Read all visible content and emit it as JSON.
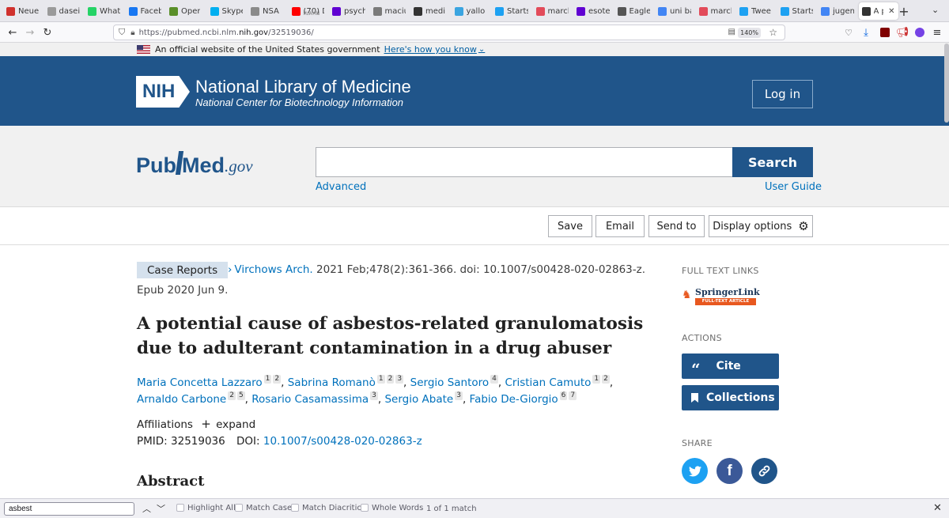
{
  "browser": {
    "tabs": [
      {
        "label": "Neue",
        "icon": "z-icon",
        "color": "#d0312d"
      },
      {
        "label": "daseinsa",
        "icon": "blank-page-icon",
        "color": "#9a9a9a"
      },
      {
        "label": "What",
        "icon": "whatsapp-icon",
        "color": "#25d366"
      },
      {
        "label": "Faceb",
        "icon": "facebook-icon",
        "color": "#1877f2"
      },
      {
        "label": "Oper",
        "icon": "app-icon",
        "color": "#5a8f29"
      },
      {
        "label": "Skype",
        "icon": "skype-icon",
        "color": "#00aff0"
      },
      {
        "label": "NSA",
        "icon": "flag-icon",
        "color": "#8a8a8a"
      },
      {
        "label": "(70) D",
        "sublabel": "PLAYIN",
        "icon": "youtube-icon",
        "color": "#ff0000"
      },
      {
        "label": "psych",
        "icon": "yahoo-icon",
        "color": "#6001d2"
      },
      {
        "label": "maciu",
        "icon": "globe-icon",
        "color": "#7a7a7a"
      },
      {
        "label": "medi",
        "icon": "github-icon",
        "color": "#333333"
      },
      {
        "label": "yallo",
        "icon": "bar-chart-icon",
        "color": "#3aa4e0"
      },
      {
        "label": "Starts",
        "icon": "twitter-icon",
        "color": "#1da1f2"
      },
      {
        "label": "marcl",
        "icon": "page-icon",
        "color": "#e24b5a"
      },
      {
        "label": "esote",
        "icon": "yahoo-icon",
        "color": "#6001d2"
      },
      {
        "label": "Eagle",
        "icon": "wikipedia-icon",
        "color": "#555555"
      },
      {
        "label": "uni ba",
        "icon": "google-icon",
        "color": "#4285f4"
      },
      {
        "label": "marcl",
        "icon": "page-icon",
        "color": "#e24b5a"
      },
      {
        "label": "Twee",
        "icon": "tweetdeck-icon",
        "color": "#1da1f2"
      },
      {
        "label": "Starts",
        "icon": "twitter-icon",
        "color": "#1da1f2"
      },
      {
        "label": "jugen",
        "icon": "google-icon",
        "color": "#4285f4"
      },
      {
        "label": "A p",
        "icon": "pubmed-tab-icon",
        "color": "#333333",
        "active": true
      }
    ],
    "new_tab": "+",
    "url_prefix": "https://pubmed.ncbi.nlm.",
    "url_domain": "nih.gov",
    "url_path": "/32519036/",
    "zoom": "140%"
  },
  "gov_banner": {
    "text": "An official website of the United States government",
    "link": "Here's how you know"
  },
  "nlm": {
    "logo": "NIH",
    "title": "National Library of Medicine",
    "subtitle": "National Center for Biotechnology Information",
    "login": "Log in"
  },
  "pubmed": {
    "logo_pub": "Pub",
    "logo_med": "Med",
    "logo_gov": ".gov",
    "search_value": "",
    "search_button": "Search",
    "advanced": "Advanced",
    "user_guide": "User Guide"
  },
  "toolbar": {
    "save": "Save",
    "email": "Email",
    "send_to": "Send to",
    "display_options": "Display options"
  },
  "article": {
    "type_badge": "Case Reports",
    "journal": "Virchows Arch.",
    "citation": "2021 Feb;478(2):361-366. doi: 10.1007/s00428-020-02863-z.",
    "epub": "Epub 2020 Jun 9.",
    "title_line1": "A potential cause of asbestos-related granulomatosis",
    "title_line2": "due to adulterant contamination in a drug abuser",
    "authors": [
      {
        "name": "Maria Concetta Lazzaro",
        "aff": [
          "1",
          "2"
        ]
      },
      {
        "name": "Sabrina Romanò",
        "aff": [
          "1",
          "2",
          "3"
        ]
      },
      {
        "name": "Sergio Santoro",
        "aff": [
          "4"
        ]
      },
      {
        "name": "Cristian Camuto",
        "aff": [
          "1",
          "2"
        ]
      },
      {
        "name": "Arnaldo Carbone",
        "aff": [
          "2",
          "5"
        ]
      },
      {
        "name": "Rosario Casamassima",
        "aff": [
          "3"
        ]
      },
      {
        "name": "Sergio Abate",
        "aff": [
          "3"
        ]
      },
      {
        "name": "Fabio De-Giorgio",
        "aff": [
          "6",
          "7"
        ]
      }
    ],
    "affiliations_label": "Affiliations",
    "expand": "expand",
    "pmid_label": "PMID:",
    "pmid": "32519036",
    "doi_label": "DOI:",
    "doi": "10.1007/s00428-020-02863-z",
    "abstract_heading": "Abstract"
  },
  "sidebar": {
    "full_text_links": "FULL TEXT LINKS",
    "springer_name": "SpringerLink",
    "springer_sub": "FULL-TEXT ARTICLE",
    "actions": "ACTIONS",
    "cite": "Cite",
    "collections": "Collections",
    "share": "SHARE"
  },
  "findbar": {
    "query": "asbest",
    "highlight_all": "Highlight All",
    "match_case": "Match Case",
    "match_diacritics": "Match Diacritics",
    "whole_words": "Whole Words",
    "result": "1 of 1 match"
  },
  "colors": {
    "nlm_blue": "#20558a",
    "link_blue": "#0071bc",
    "twitter": "#1da1f2",
    "facebook": "#3b5998",
    "copy_link": "#20558a",
    "springer_orange": "#e8581f"
  }
}
